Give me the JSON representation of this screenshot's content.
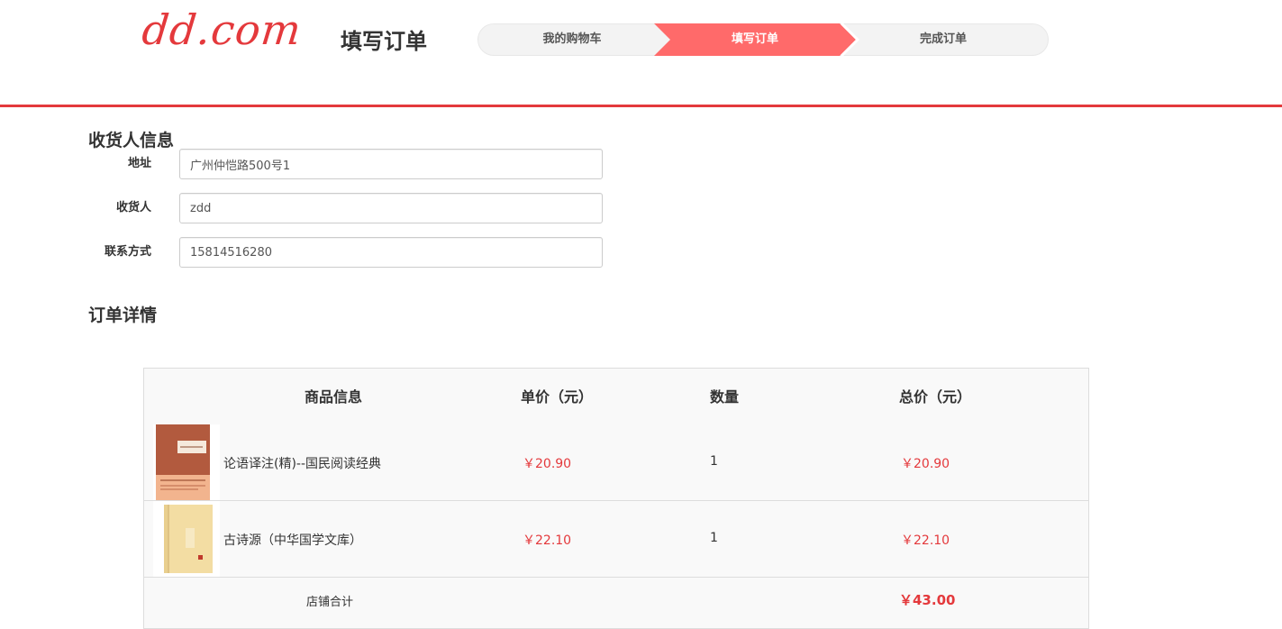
{
  "header": {
    "logo": "dd.com",
    "title": "填写订单",
    "steps": [
      "我的购物车",
      "填写订单",
      "完成订单"
    ]
  },
  "receiver": {
    "section_title": "收货人信息",
    "address_label": "地址",
    "address_value": "广州仲恺路500号1",
    "name_label": "收货人",
    "name_value": "zdd",
    "phone_label": "联系方式",
    "phone_value": "15814516280"
  },
  "order": {
    "section_title": "订单详情",
    "columns": [
      "商品信息",
      "单价（元）",
      "数量",
      "总价（元）"
    ],
    "items": [
      {
        "name": "论语译注(精)--国民阅读经典",
        "unit_price": "￥20.90",
        "quantity": "1",
        "total": "￥20.90"
      },
      {
        "name": "古诗源（中华国学文库）",
        "unit_price": "￥22.10",
        "quantity": "1",
        "total": "￥22.10"
      }
    ],
    "subtotal_label": "店铺合计",
    "subtotal_value": "￥43.00"
  },
  "colors": {
    "brand": "#e4393c",
    "step_active": "#ff6a6a"
  },
  "icons": [
    "book-cover-lunyu",
    "book-cover-gushiyuan"
  ]
}
